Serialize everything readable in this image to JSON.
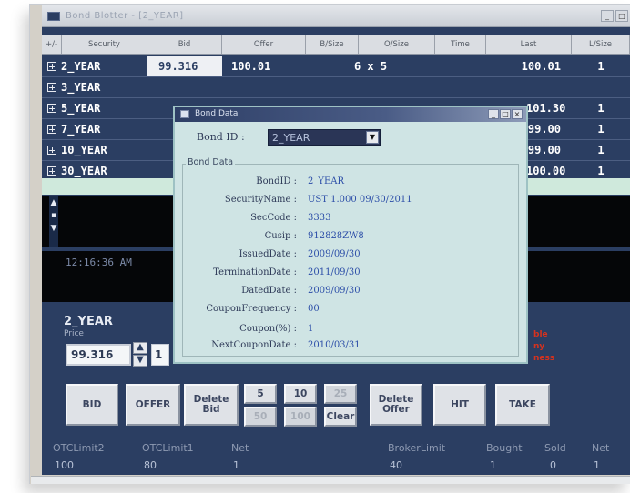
{
  "window": {
    "title": "Bond Blotter - [2_YEAR]"
  },
  "grid": {
    "columns": [
      "+/-",
      "Security",
      "Bid",
      "Offer",
      "B/Size",
      "O/Size",
      "Time",
      "Last",
      "L/Size"
    ],
    "rows": [
      {
        "security": "2_YEAR",
        "bid": "99.316",
        "offer": "100.01",
        "size": "6 x 5",
        "last": "100.01",
        "lsize": "1"
      },
      {
        "security": "3_YEAR",
        "bid": "",
        "offer": "",
        "size": "",
        "last": "",
        "lsize": ""
      },
      {
        "security": "5_YEAR",
        "bid": "",
        "offer": "",
        "size": "",
        "last": "101.30",
        "lsize": "1"
      },
      {
        "security": "7_YEAR",
        "bid": "",
        "offer": "",
        "size": "",
        "last": "99.00",
        "lsize": "1"
      },
      {
        "security": "10_YEAR",
        "bid": "",
        "offer": "",
        "size": "",
        "last": "99.00",
        "lsize": "1"
      },
      {
        "security": "30_YEAR",
        "bid": "",
        "offer": "",
        "size": "",
        "last": "100.00",
        "lsize": "1"
      }
    ]
  },
  "ticker": {
    "time": "12:16:36 AM"
  },
  "order": {
    "security": "2_YEAR",
    "price_label": "Price",
    "price": "99.316",
    "qty": "1",
    "spin_up": "▲",
    "spin_down": "▼"
  },
  "red_notes": [
    "ble",
    "ny",
    "ness"
  ],
  "buttons": {
    "bid": "BID",
    "offer": "OFFER",
    "delete_bid": "Delete Bid",
    "s5": "5",
    "s10": "10",
    "s25": "25",
    "s50": "50",
    "s100": "100",
    "clear": "Clear",
    "delete_offer": "Delete Offer",
    "hit": "HIT",
    "take": "TAKE"
  },
  "stats": {
    "labels": [
      "OTCLimit2",
      "OTCLimit1",
      "Net",
      "BrokerLimit",
      "Bought",
      "Sold",
      "Net"
    ],
    "values": [
      "100",
      "80",
      "1",
      "40",
      "1",
      "0",
      "1"
    ]
  },
  "dialog": {
    "title": "Bond Data",
    "bond_id_label": "Bond ID :",
    "bond_id_value": "2_YEAR",
    "group_label": "Bond Data",
    "fields": [
      {
        "label": "BondID :",
        "value": "2_YEAR"
      },
      {
        "label": "SecurityName :",
        "value": "UST 1.000 09/30/2011"
      },
      {
        "label": "SecCode :",
        "value": "3333"
      },
      {
        "label": "Cusip :",
        "value": "912828ZW8"
      },
      {
        "label": "IssuedDate :",
        "value": "2009/09/30"
      },
      {
        "label": "TerminationDate :",
        "value": "2011/09/30"
      },
      {
        "label": "DatedDate :",
        "value": "2009/09/30"
      },
      {
        "label": "CouponFrequency :",
        "value": "00"
      },
      {
        "label": "Coupon(%) :",
        "value": "1"
      },
      {
        "label": "NextCouponDate :",
        "value": "2010/03/31"
      }
    ]
  },
  "colors": {
    "app_bg": "#2b3e62",
    "dialog_bg": "#cfe4e4",
    "value_blue": "#2c4ea8",
    "accent_red": "#d6321e"
  }
}
